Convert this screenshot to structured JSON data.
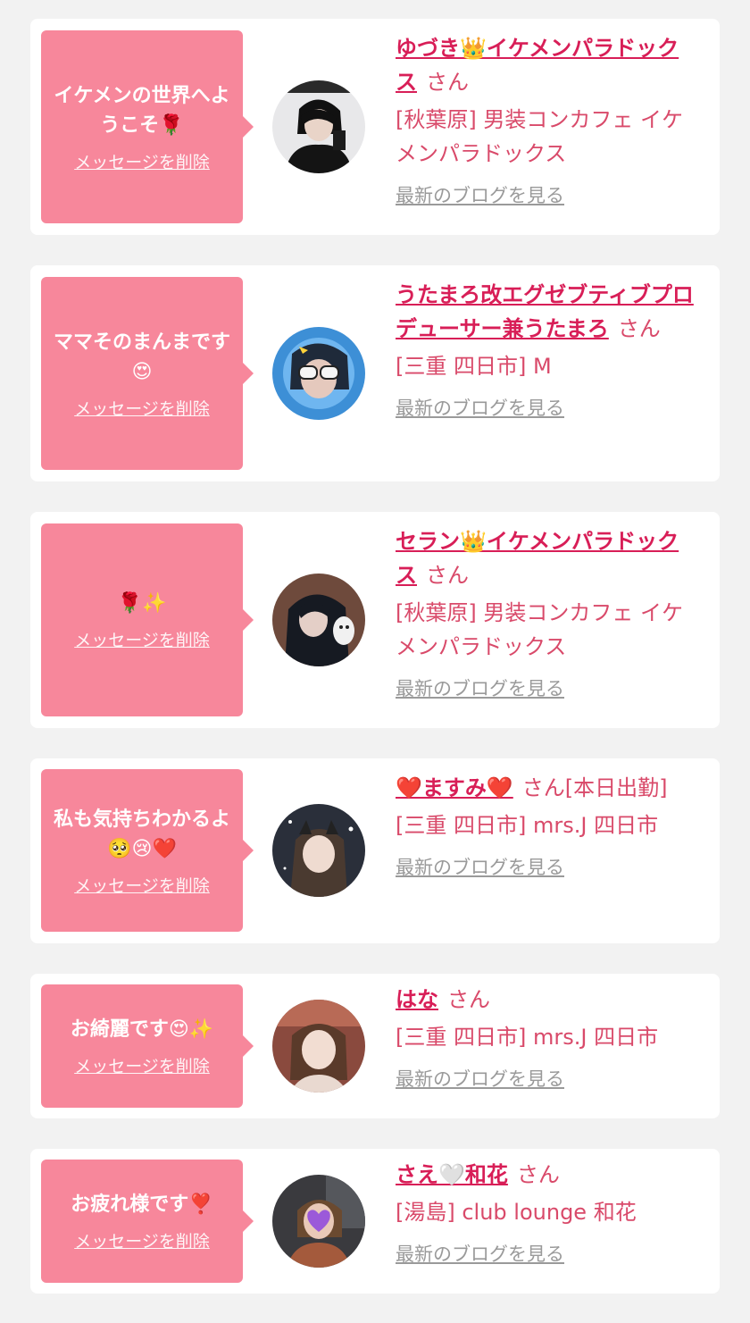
{
  "messages": [
    {
      "message": "イケメンの世界へようこそ🌹",
      "delete_label": "メッセージを削除",
      "name": "ゆづき👑イケメンパラドックス",
      "honorific": "さん",
      "shop": "[秋葉原] 男装コンカフェ イケメンパラドックス",
      "blog_link": "最新のブログを見る"
    },
    {
      "message": "ママそのまんまです😍",
      "delete_label": "メッセージを削除",
      "name": "うたまろ改エグゼブティブプロデューサー兼うたまろ",
      "honorific": "さん",
      "shop": "[三重 四日市] M",
      "blog_link": "最新のブログを見る"
    },
    {
      "message": "🌹✨",
      "delete_label": "メッセージを削除",
      "name": "セラン👑イケメンパラドックス",
      "honorific": "さん",
      "shop": "[秋葉原] 男装コンカフェ イケメンパラドックス",
      "blog_link": "最新のブログを見る"
    },
    {
      "message": "私も気持ちわかるよ🥺😢❤️",
      "delete_label": "メッセージを削除",
      "name": "❤️ますみ❤️",
      "honorific": "さん[本日出勤]",
      "shop": "[三重 四日市] mrs.J 四日市",
      "blog_link": "最新のブログを見る"
    },
    {
      "message": "お綺麗です😍✨",
      "delete_label": "メッセージを削除",
      "name": "はな",
      "honorific": "さん",
      "shop": "[三重 四日市] mrs.J 四日市",
      "blog_link": "最新のブログを見る"
    },
    {
      "message": "お疲れ様です❣️",
      "delete_label": "メッセージを削除",
      "name": "さえ🤍和花",
      "honorific": "さん",
      "shop": "[湯島] club lounge 和花",
      "blog_link": "最新のブログを見る"
    }
  ],
  "colors": {
    "bubble": "#f7879b",
    "name": "#d81e57",
    "text": "#d94a6a",
    "link_gray": "#9a9a9a",
    "background": "#f2f2f2"
  }
}
